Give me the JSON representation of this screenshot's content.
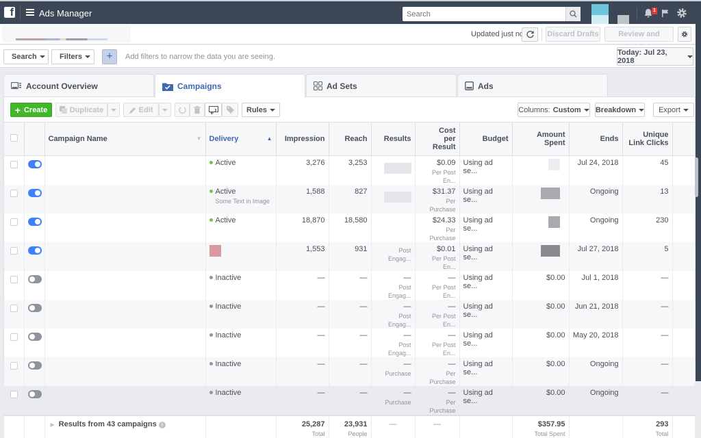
{
  "app": {
    "title": "Ads Manager",
    "logo": "f"
  },
  "topbar": {
    "search_placeholder": "Search",
    "notification_count": "1",
    "icons": [
      "facebook-logo-icon",
      "hamburger-menu-icon",
      "search-icon",
      "bell-icon",
      "flag-icon",
      "gear-icon"
    ]
  },
  "subbar": {
    "updated": "Updated just now",
    "discard": "Discard Drafts",
    "review": "Review and Publish"
  },
  "filterbar": {
    "search_label": "Search",
    "filters_label": "Filters",
    "add_label": "+",
    "hint": "Add filters to narrow the data you are seeing.",
    "date_label": "Today: Jul 23, 2018"
  },
  "tabs": [
    {
      "label": "Account Overview",
      "icon": "account-overview-icon"
    },
    {
      "label": "Campaigns",
      "icon": "campaigns-folder-icon",
      "active": true
    },
    {
      "label": "Ad Sets",
      "icon": "ad-sets-grid-icon"
    },
    {
      "label": "Ads",
      "icon": "ads-icon"
    }
  ],
  "toolbar": {
    "create": "Create",
    "duplicate": "Duplicate",
    "edit": "Edit",
    "rules": "Rules",
    "columns_prefix": "Columns:",
    "columns_value": "Custom",
    "breakdown": "Breakdown",
    "export": "Export"
  },
  "table": {
    "headers": {
      "name": "Campaign Name",
      "delivery": "Delivery",
      "impressions": "Impression",
      "reach": "Reach",
      "results": "Results",
      "cpr": "Cost per Result",
      "budget": "Budget",
      "spent": "Amount Spent",
      "ends": "Ends",
      "clicks": "Unique Link Clicks"
    },
    "rows": [
      {
        "on": true,
        "delivery": "Active",
        "delivery_sub": "",
        "impressions": "3,276",
        "reach": "3,253",
        "results": "",
        "results_sub": "",
        "cpr": "$0.09",
        "cpr_sub": "Per Post En...",
        "budget": "Using ad se...",
        "spent": "",
        "ends": "Jul 24, 2018",
        "clicks": "45"
      },
      {
        "on": true,
        "delivery": "Active",
        "delivery_sub": "Some Text in Image",
        "impressions": "1,588",
        "reach": "827",
        "results": "",
        "results_sub": "",
        "cpr": "$31.37",
        "cpr_sub": "Per Purchase",
        "budget": "Using ad se...",
        "spent": "",
        "ends": "Ongoing",
        "clicks": "13"
      },
      {
        "on": true,
        "delivery": "Active",
        "delivery_sub": "",
        "impressions": "18,870",
        "reach": "18,580",
        "results": "",
        "results_sub": "",
        "cpr": "$24.33",
        "cpr_sub": "Per Purchase",
        "budget": "Using ad se...",
        "spent": "",
        "ends": "Ongoing",
        "clicks": "230"
      },
      {
        "on": true,
        "delivery": "",
        "delivery_sub": "",
        "impressions": "1,553",
        "reach": "931",
        "results": "",
        "results_sub": "Post Engag...",
        "cpr": "$0.01",
        "cpr_sub": "Per Post En...",
        "budget": "Using ad se...",
        "spent": "",
        "ends": "Jul 27, 2018",
        "clicks": "5"
      },
      {
        "on": false,
        "delivery": "Inactive",
        "delivery_sub": "",
        "impressions": "—",
        "reach": "—",
        "results": "—",
        "results_sub": "Post Engag...",
        "cpr": "—",
        "cpr_sub": "Per Post En...",
        "budget": "Using ad se...",
        "spent": "$0.00",
        "ends": "Jul 1, 2018",
        "clicks": "—"
      },
      {
        "on": false,
        "delivery": "Inactive",
        "delivery_sub": "",
        "impressions": "—",
        "reach": "—",
        "results": "—",
        "results_sub": "Post Engag...",
        "cpr": "—",
        "cpr_sub": "Per Post En...",
        "budget": "Using ad se...",
        "spent": "$0.00",
        "ends": "Jun 21, 2018",
        "clicks": "—"
      },
      {
        "on": false,
        "delivery": "Inactive",
        "delivery_sub": "",
        "impressions": "—",
        "reach": "—",
        "results": "—",
        "results_sub": "Post Engag...",
        "cpr": "—",
        "cpr_sub": "Per Post En...",
        "budget": "Using ad se...",
        "spent": "$0.00",
        "ends": "May 20, 2018",
        "clicks": "—"
      },
      {
        "on": false,
        "delivery": "Inactive",
        "delivery_sub": "",
        "impressions": "—",
        "reach": "—",
        "results": "—",
        "results_sub": "Purchase",
        "cpr": "—",
        "cpr_sub": "Per Purchase",
        "budget": "Using ad se...",
        "spent": "$0.00",
        "ends": "Ongoing",
        "clicks": "—"
      },
      {
        "on": false,
        "delivery": "Inactive",
        "delivery_sub": "",
        "impressions": "—",
        "reach": "—",
        "results": "—",
        "results_sub": "Purchase",
        "cpr": "—",
        "cpr_sub": "Per Purchase",
        "budget": "Using ad se...",
        "spent": "$0.00",
        "ends": "Ongoing",
        "clicks": "—"
      }
    ],
    "footer": {
      "label": "Results from 43 campaigns",
      "impressions": "25,287",
      "impressions_sub": "Total",
      "reach": "23,931",
      "reach_sub": "People",
      "results": "—",
      "cpr": "—",
      "spent": "$357.95",
      "spent_sub": "Total Spent",
      "clicks": "293",
      "clicks_sub": "Total"
    }
  },
  "colors": {
    "active": "#7ac142",
    "inactive": "#90949c",
    "accent": "#4267b2",
    "create": "#42b72a",
    "topbar": "#3b4656"
  }
}
